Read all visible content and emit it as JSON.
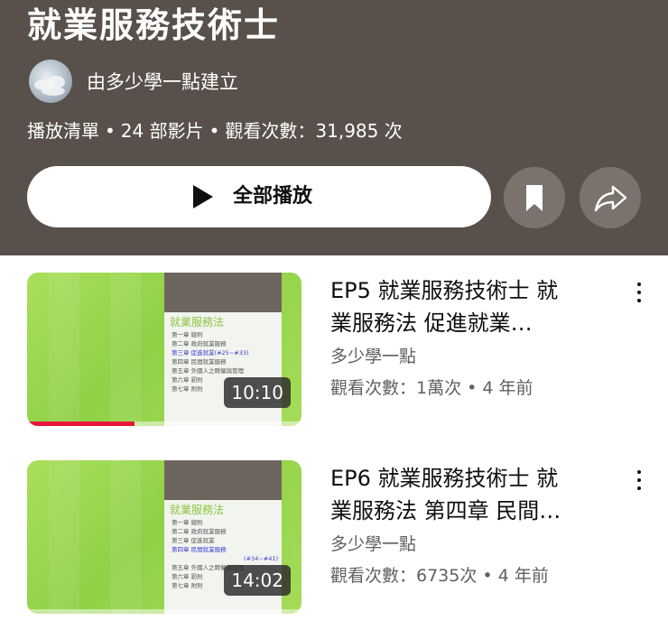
{
  "playlist": {
    "title": "就業服務技術士",
    "creator": "由多少學一點建立",
    "type_label": "播放清單",
    "video_count": "24 部影片",
    "views": "觀看次數：31,985 次",
    "play_all_label": "全部播放",
    "accent_color": "#58504a"
  },
  "videos": [
    {
      "title_line1": "EP5 就業服務技術士 就",
      "title_line2": "業服務法 促進就業…",
      "channel": "多少學一點",
      "views": "觀看次數：1萬次",
      "age": "4 年前",
      "duration": "10:10",
      "watched_fraction": 0.39,
      "thumb": {
        "slide_title": "就業服務法",
        "toc": [
          "第一章 總則",
          "第二章 政府就業服務",
          "第三章 促進就業(#25~#33)",
          "第四章 民間就業服務",
          "第五章 外國人之聘僱與管理",
          "第六章 罰則",
          "第七章 附則"
        ],
        "highlight_index": 2
      }
    },
    {
      "title_line1": "EP6 就業服務技術士 就",
      "title_line2": "業服務法 第四章 民間…",
      "channel": "多少學一點",
      "views": "觀看次數：6735次",
      "age": "4 年前",
      "duration": "14:02",
      "watched_fraction": 0.0,
      "thumb": {
        "slide_title": "就業服務法",
        "toc": [
          "第一章 總則",
          "第二章 政府就業服務",
          "第三章 促進就業",
          "第四章 民間就業服務",
          "(#34~#41)",
          "第五章 外國人之聘僱與管理",
          "第六章 罰則",
          "第七章 附則"
        ],
        "highlight_index": 3
      }
    }
  ],
  "icons": {
    "play": "play-icon",
    "save": "bookmark-icon",
    "share": "share-icon",
    "more": "more-vert-icon"
  }
}
